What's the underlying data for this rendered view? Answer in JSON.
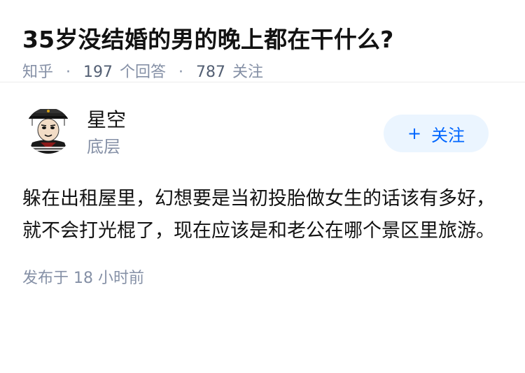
{
  "question": {
    "title": "35岁没结婚的男的晚上都在干什么?",
    "source": "知乎",
    "answer_count": "197",
    "answer_label": "个回答",
    "follow_count": "787",
    "follow_label": "关注"
  },
  "answer": {
    "author": {
      "name": "星空",
      "headline": "底层"
    },
    "follow_button": {
      "plus": "+",
      "label": "关注"
    },
    "content": "躲在出租屋里，幻想要是当初投胎做女生的话该有多好，就不会打光棍了，现在应该是和老公在哪个景区里旅游。",
    "published": "发布于 18 小时前"
  },
  "colors": {
    "title": "#121212",
    "meta": "#8590a6",
    "accent": "#0066ff",
    "follow_bg": "#ebf5ff"
  },
  "icons": {
    "avatar": "meme-avatar-image"
  }
}
